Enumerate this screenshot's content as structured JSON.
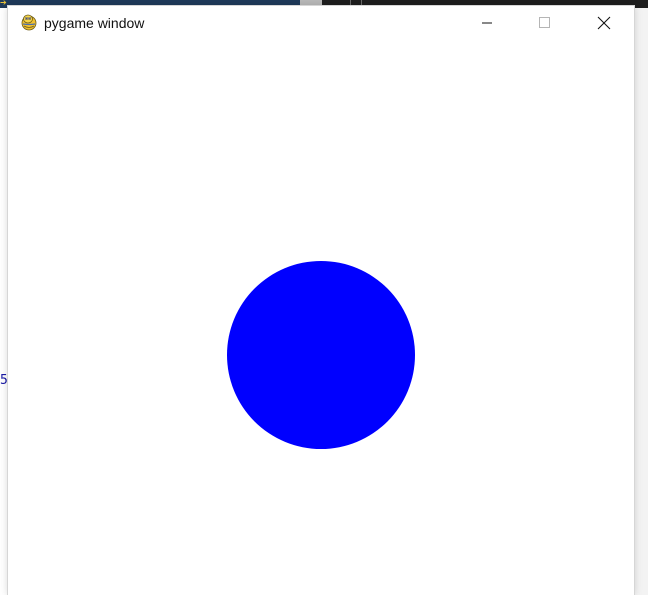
{
  "window": {
    "title": "pygame window",
    "icon": "pygame-snake-icon",
    "controls": {
      "minimize_icon": "minimize-icon",
      "maximize_icon": "maximize-icon",
      "close_icon": "close-icon"
    }
  },
  "background_app": {
    "partial_text": "5"
  },
  "scene": {
    "background_color": "#ffffff",
    "ball_color": "#0000ff",
    "ball_shape": "circle"
  }
}
